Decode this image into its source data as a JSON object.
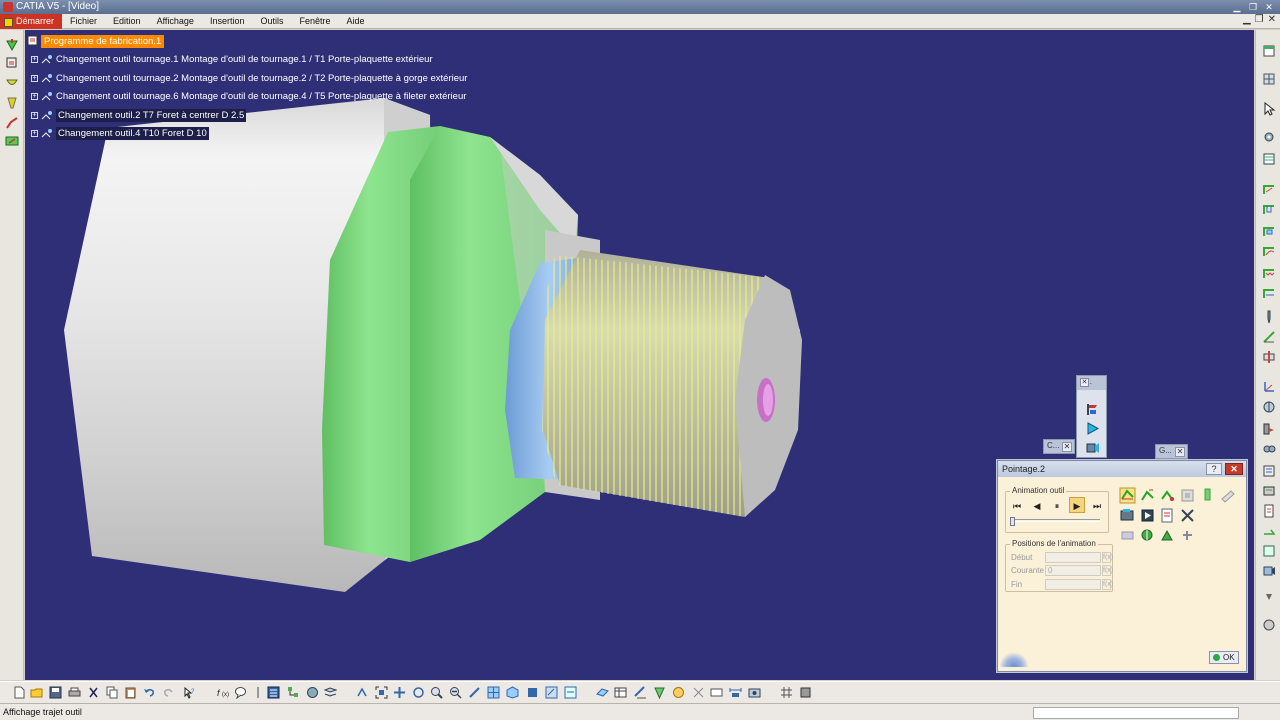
{
  "window": {
    "title": "CATIA V5 - [Video]"
  },
  "menu": [
    "Démarrer",
    "Fichier",
    "Edition",
    "Affichage",
    "Insertion",
    "Outils",
    "Fenêtre",
    "Aide"
  ],
  "tree": {
    "root": "Programme de fabrication.1",
    "items": [
      "Changement outil tournage.1  Montage d'outil de tournage.1 / T1 Porte-plaquette extérieur",
      "Changement outil tournage.2  Montage d'outil de tournage.2 / T2 Porte-plaquette à gorge extérieur",
      "Changement outil tournage.6  Montage d'outil de tournage.4 / T5 Porte-plaquette à fileter extérieur",
      "Changement outil.2  T7 Foret à centrer D 2.5",
      "Changement outil.4  T10 Foret D 10"
    ]
  },
  "colors": {
    "background": "#2f2f78",
    "body_white": "#ececec",
    "body_green": "#86d98a",
    "body_blue": "#8ab6e6",
    "thread": "#d6dc8a",
    "root_highlight": "#ff8a00"
  },
  "mini_toolbars": {
    "a": "S...",
    "b": "C...",
    "c": "G..."
  },
  "dialog": {
    "title": "Pointage.2",
    "help": "?",
    "close": "✕",
    "animation_group": "Animation outil",
    "positions_group": "Positions de l'animation",
    "fields": {
      "debut": "Début",
      "courante": "Courante",
      "fin": "Fin",
      "courante_value": "0"
    },
    "ok": "OK"
  },
  "status": {
    "text": "Affichage trajet outil"
  }
}
